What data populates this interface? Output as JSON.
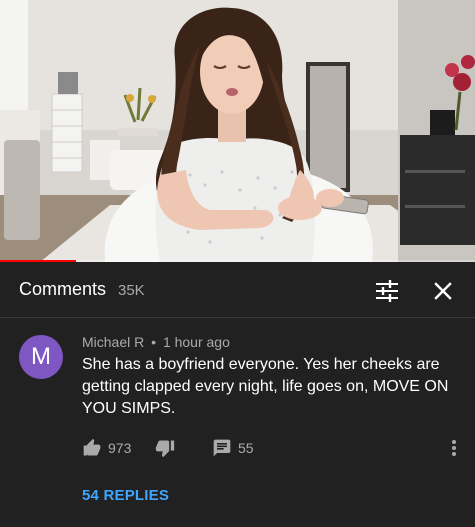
{
  "player": {
    "progress_fraction": 0.16,
    "progress_color": "#ff0000"
  },
  "comments_panel": {
    "title": "Comments",
    "count": "35K",
    "filter_icon": "sort-sliders-icon",
    "close_icon": "close-icon"
  },
  "comment": {
    "avatar_letter": "M",
    "avatar_color": "#7e57c2",
    "author": "Michael R",
    "separator": "•",
    "time": "1 hour ago",
    "text": "She has a boyfriend everyone. Yes her cheeks are getting clapped every night, life goes on, MOVE ON YOU SIMPS.",
    "likes": "973",
    "replies_count": "55",
    "replies_link": "54 REPLIES",
    "icons": {
      "like": "thumbs-up-icon",
      "dislike": "thumbs-down-icon",
      "reply": "reply-comment-icon",
      "more": "more-vert-icon"
    }
  },
  "colors": {
    "background": "#212121",
    "link": "#3ea6ff",
    "secondary_text": "#aaaaaa"
  }
}
